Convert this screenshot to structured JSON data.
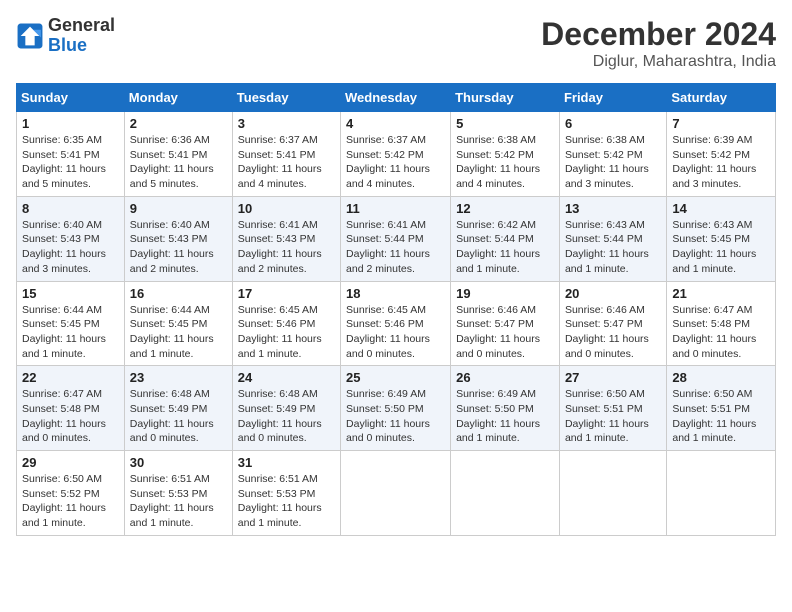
{
  "logo": {
    "line1": "General",
    "line2": "Blue"
  },
  "title": "December 2024",
  "subtitle": "Diglur, Maharashtra, India",
  "days_of_week": [
    "Sunday",
    "Monday",
    "Tuesday",
    "Wednesday",
    "Thursday",
    "Friday",
    "Saturday"
  ],
  "weeks": [
    [
      {
        "day": "1",
        "sunrise": "6:35 AM",
        "sunset": "5:41 PM",
        "daylight": "11 hours and 5 minutes."
      },
      {
        "day": "2",
        "sunrise": "6:36 AM",
        "sunset": "5:41 PM",
        "daylight": "11 hours and 5 minutes."
      },
      {
        "day": "3",
        "sunrise": "6:37 AM",
        "sunset": "5:41 PM",
        "daylight": "11 hours and 4 minutes."
      },
      {
        "day": "4",
        "sunrise": "6:37 AM",
        "sunset": "5:42 PM",
        "daylight": "11 hours and 4 minutes."
      },
      {
        "day": "5",
        "sunrise": "6:38 AM",
        "sunset": "5:42 PM",
        "daylight": "11 hours and 4 minutes."
      },
      {
        "day": "6",
        "sunrise": "6:38 AM",
        "sunset": "5:42 PM",
        "daylight": "11 hours and 3 minutes."
      },
      {
        "day": "7",
        "sunrise": "6:39 AM",
        "sunset": "5:42 PM",
        "daylight": "11 hours and 3 minutes."
      }
    ],
    [
      {
        "day": "8",
        "sunrise": "6:40 AM",
        "sunset": "5:43 PM",
        "daylight": "11 hours and 3 minutes."
      },
      {
        "day": "9",
        "sunrise": "6:40 AM",
        "sunset": "5:43 PM",
        "daylight": "11 hours and 2 minutes."
      },
      {
        "day": "10",
        "sunrise": "6:41 AM",
        "sunset": "5:43 PM",
        "daylight": "11 hours and 2 minutes."
      },
      {
        "day": "11",
        "sunrise": "6:41 AM",
        "sunset": "5:44 PM",
        "daylight": "11 hours and 2 minutes."
      },
      {
        "day": "12",
        "sunrise": "6:42 AM",
        "sunset": "5:44 PM",
        "daylight": "11 hours and 1 minute."
      },
      {
        "day": "13",
        "sunrise": "6:43 AM",
        "sunset": "5:44 PM",
        "daylight": "11 hours and 1 minute."
      },
      {
        "day": "14",
        "sunrise": "6:43 AM",
        "sunset": "5:45 PM",
        "daylight": "11 hours and 1 minute."
      }
    ],
    [
      {
        "day": "15",
        "sunrise": "6:44 AM",
        "sunset": "5:45 PM",
        "daylight": "11 hours and 1 minute."
      },
      {
        "day": "16",
        "sunrise": "6:44 AM",
        "sunset": "5:45 PM",
        "daylight": "11 hours and 1 minute."
      },
      {
        "day": "17",
        "sunrise": "6:45 AM",
        "sunset": "5:46 PM",
        "daylight": "11 hours and 1 minute."
      },
      {
        "day": "18",
        "sunrise": "6:45 AM",
        "sunset": "5:46 PM",
        "daylight": "11 hours and 0 minutes."
      },
      {
        "day": "19",
        "sunrise": "6:46 AM",
        "sunset": "5:47 PM",
        "daylight": "11 hours and 0 minutes."
      },
      {
        "day": "20",
        "sunrise": "6:46 AM",
        "sunset": "5:47 PM",
        "daylight": "11 hours and 0 minutes."
      },
      {
        "day": "21",
        "sunrise": "6:47 AM",
        "sunset": "5:48 PM",
        "daylight": "11 hours and 0 minutes."
      }
    ],
    [
      {
        "day": "22",
        "sunrise": "6:47 AM",
        "sunset": "5:48 PM",
        "daylight": "11 hours and 0 minutes."
      },
      {
        "day": "23",
        "sunrise": "6:48 AM",
        "sunset": "5:49 PM",
        "daylight": "11 hours and 0 minutes."
      },
      {
        "day": "24",
        "sunrise": "6:48 AM",
        "sunset": "5:49 PM",
        "daylight": "11 hours and 0 minutes."
      },
      {
        "day": "25",
        "sunrise": "6:49 AM",
        "sunset": "5:50 PM",
        "daylight": "11 hours and 0 minutes."
      },
      {
        "day": "26",
        "sunrise": "6:49 AM",
        "sunset": "5:50 PM",
        "daylight": "11 hours and 1 minute."
      },
      {
        "day": "27",
        "sunrise": "6:50 AM",
        "sunset": "5:51 PM",
        "daylight": "11 hours and 1 minute."
      },
      {
        "day": "28",
        "sunrise": "6:50 AM",
        "sunset": "5:51 PM",
        "daylight": "11 hours and 1 minute."
      }
    ],
    [
      {
        "day": "29",
        "sunrise": "6:50 AM",
        "sunset": "5:52 PM",
        "daylight": "11 hours and 1 minute."
      },
      {
        "day": "30",
        "sunrise": "6:51 AM",
        "sunset": "5:53 PM",
        "daylight": "11 hours and 1 minute."
      },
      {
        "day": "31",
        "sunrise": "6:51 AM",
        "sunset": "5:53 PM",
        "daylight": "11 hours and 1 minute."
      },
      null,
      null,
      null,
      null
    ]
  ],
  "labels": {
    "sunrise": "Sunrise:",
    "sunset": "Sunset:",
    "daylight": "Daylight:"
  }
}
